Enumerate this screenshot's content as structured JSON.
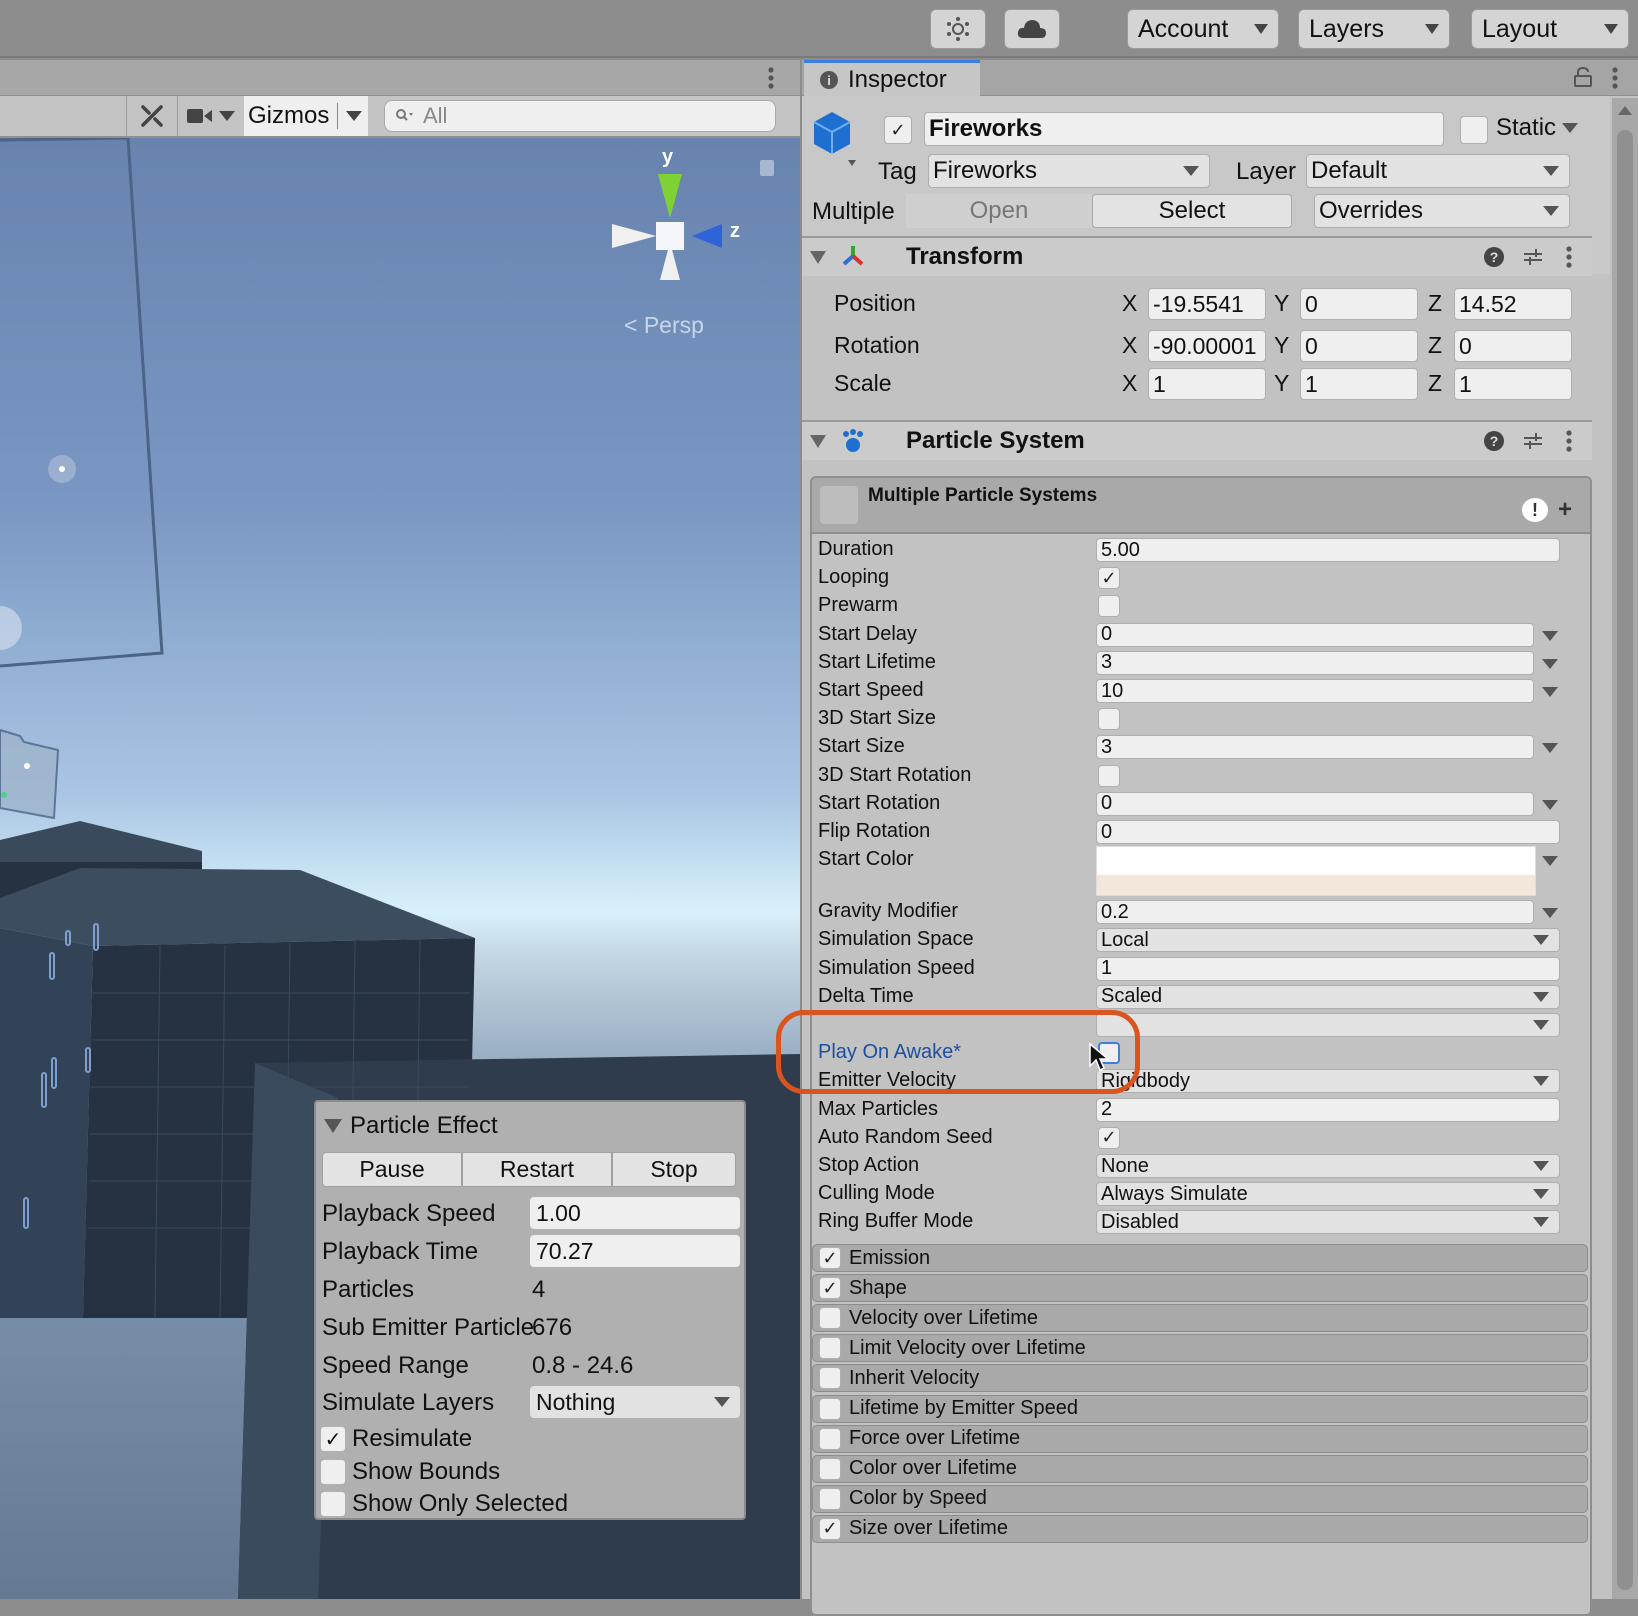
{
  "toolbar": {
    "account_label": "Account",
    "layers_label": "Layers",
    "layout_label": "Layout",
    "icons": [
      "services-icon",
      "cloud-icon"
    ]
  },
  "scene": {
    "gizmos_label": "Gizmos",
    "search_placeholder": "All",
    "axis_y": "y",
    "axis_z": "z",
    "projection_label": "Persp"
  },
  "particle_effect": {
    "title": "Particle Effect",
    "buttons": [
      "Pause",
      "Restart",
      "Stop"
    ],
    "playback_speed_label": "Playback Speed",
    "playback_speed": "1.00",
    "playback_time_label": "Playback Time",
    "playback_time": "70.27",
    "particles_label": "Particles",
    "particles": "4",
    "sub_emitter_label": "Sub Emitter Particle",
    "sub_emitter": "676",
    "speed_range_label": "Speed Range",
    "speed_range": "0.8 - 24.6",
    "simulate_layers_label": "Simulate Layers",
    "simulate_layers": "Nothing",
    "checks": [
      {
        "label": "Resimulate",
        "checked": true
      },
      {
        "label": "Show Bounds",
        "checked": false
      },
      {
        "label": "Show Only Selected",
        "checked": false
      }
    ]
  },
  "inspector": {
    "tab_label": "Inspector",
    "object_name": "Fireworks",
    "active": true,
    "static_label": "Static",
    "static": false,
    "tag_label": "Tag",
    "tag": "Fireworks",
    "layer_label": "Layer",
    "layer": "Default",
    "prefab_label": "Multiple",
    "open_label": "Open",
    "select_label": "Select",
    "overrides_label": "Overrides",
    "transform": {
      "title": "Transform",
      "rows": [
        {
          "label": "Position",
          "x": "-19.5541",
          "y": "0",
          "z": "14.52"
        },
        {
          "label": "Rotation",
          "x": "-90.00001",
          "y": "0",
          "z": "0"
        },
        {
          "label": "Scale",
          "x": "1",
          "y": "1",
          "z": "1"
        }
      ],
      "axis_labels": [
        "X",
        "Y",
        "Z"
      ]
    },
    "particle_system": {
      "title": "Particle System",
      "header": "Multiple Particle Systems",
      "start_color_top": "#ffffff",
      "start_color_bottom": "#f3e6db",
      "highlight_color": "#d9541e",
      "properties": [
        {
          "label": "Duration",
          "type": "field",
          "value": "5.00"
        },
        {
          "label": "Looping",
          "type": "check",
          "value": true
        },
        {
          "label": "Prewarm",
          "type": "check",
          "value": false
        },
        {
          "label": "Start Delay",
          "type": "field-ext",
          "value": "0"
        },
        {
          "label": "Start Lifetime",
          "type": "field-ext",
          "value": "3"
        },
        {
          "label": "Start Speed",
          "type": "field-ext",
          "value": "10"
        },
        {
          "label": "3D Start Size",
          "type": "check",
          "value": false
        },
        {
          "label": "Start Size",
          "type": "field-ext",
          "value": "3"
        },
        {
          "label": "3D Start Rotation",
          "type": "check",
          "value": false
        },
        {
          "label": "Start Rotation",
          "type": "field-ext",
          "value": "0"
        },
        {
          "label": "Flip Rotation",
          "type": "field",
          "value": "0"
        },
        {
          "label": "Start Color",
          "type": "color",
          "value": ""
        },
        {
          "label": "Gravity Modifier",
          "type": "field-ext",
          "value": "0.2"
        },
        {
          "label": "Simulation Space",
          "type": "dropdown",
          "value": "Local"
        },
        {
          "label": "Simulation Speed",
          "type": "field",
          "value": "1"
        },
        {
          "label": "Delta Time",
          "type": "dropdown",
          "value": "Scaled"
        },
        {
          "label": "",
          "type": "dropdown",
          "value": ""
        },
        {
          "label": "Play On Awake*",
          "type": "check",
          "value": false,
          "modified": true
        },
        {
          "label": "Emitter Velocity",
          "type": "dropdown",
          "value": "Rigidbody"
        },
        {
          "label": "Max Particles",
          "type": "field",
          "value": "2"
        },
        {
          "label": "Auto Random Seed",
          "type": "check",
          "value": true
        },
        {
          "label": "Stop Action",
          "type": "dropdown",
          "value": "None"
        },
        {
          "label": "Culling Mode",
          "type": "dropdown",
          "value": "Always Simulate"
        },
        {
          "label": "Ring Buffer Mode",
          "type": "dropdown",
          "value": "Disabled"
        }
      ],
      "modules": [
        {
          "label": "Emission",
          "enabled": true
        },
        {
          "label": "Shape",
          "enabled": true
        },
        {
          "label": "Velocity over Lifetime",
          "enabled": false
        },
        {
          "label": "Limit Velocity over Lifetime",
          "enabled": false
        },
        {
          "label": "Inherit Velocity",
          "enabled": false
        },
        {
          "label": "Lifetime by Emitter Speed",
          "enabled": false
        },
        {
          "label": "Force over Lifetime",
          "enabled": false
        },
        {
          "label": "Color over Lifetime",
          "enabled": false
        },
        {
          "label": "Color by Speed",
          "enabled": false
        },
        {
          "label": "Size over Lifetime",
          "enabled": true
        }
      ]
    }
  }
}
